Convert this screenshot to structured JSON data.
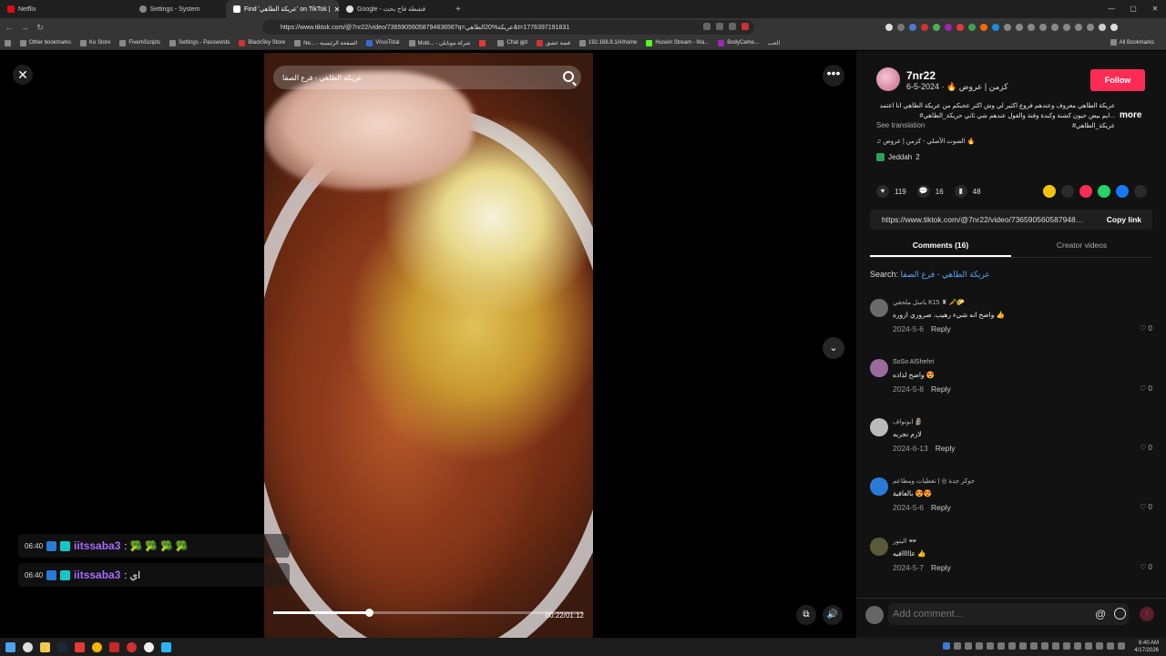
{
  "browser": {
    "tabs": [
      {
        "label": "Netflix",
        "color": "#e50914"
      },
      {
        "label": "Settings - System",
        "color": "#888888"
      },
      {
        "label": "Find 'عريكة الطاهي' on TikTok |",
        "color": "#ffffff",
        "active": true
      },
      {
        "label": "Google - قشطة فاخ بحث",
        "color": "#dddddd"
      }
    ],
    "url": "https://www.tiktok.com/@7nr22/video/7365905605879483656?q=عريكة%20الطاهي&t=1776397191831",
    "bookmarks": [
      "Other bookmarks",
      "Ko Store",
      "FivemScripts",
      "Settings - Passwords",
      "BlackSky Store",
      "Ne... - الصفحة الرئيسية",
      "VirusTotal",
      "Mobi... - شركة موبايلي",
      "",
      "Chat gpt",
      "قصة عشق",
      "192.168.8.1/#/home",
      "Husein Stream - Wa...",
      "BodyCame...",
      "الجب"
    ],
    "all_bookmarks": "All Bookmarks"
  },
  "video": {
    "search_placeholder": "عريكة الطاهي - فرع الصفا",
    "time": "00:22/01:12",
    "progress": 0.31
  },
  "chat": [
    {
      "time": "06:40",
      "user": "iitssaba3",
      "msg": ": 🥦 🥦 🥦 🥦"
    },
    {
      "time": "06:40",
      "user": "iitssaba3",
      "msg": ": اي"
    }
  ],
  "panel": {
    "author": "7nr22",
    "author_sub": "كزمن | عروض 🔥 · 2024-5-6",
    "follow": "Follow",
    "desc": "عريكة الطاهي معروف وعندهم فروع اكثير لي وش اكثر عجبكم من عريكة الطاهي انا اعتمد ...ايم بيض حيون كشنة وكبدة وفنة والفول عندهم شي ثاني حريكة_الطاهي# عريكة_الطاهي#",
    "more": "more",
    "see_translation": "See translation",
    "music": "♫  الصوت الأصلي - كزمن | عروض 🔥",
    "location": "Jeddah",
    "location_count": "2",
    "likes": "119",
    "comments_count": "16",
    "saves": "48",
    "link": "https://www.tiktok.com/@7nr22/video/7365905605879483656",
    "copy_link": "Copy link",
    "tab_comments": "Comments (16)",
    "tab_creator": "Creator videos",
    "search_label": "Search:",
    "search_query": "عريكة الطاهي - فرع الصفا",
    "add_comment": "Add comment...",
    "reply": "Reply",
    "comments": [
      {
        "user": "باسل ملحقي K15 ♜ 🥕🌮",
        "text": "واضح انه شيء رهيب. ضروري ازوره 👍",
        "date": "2024-5-6",
        "likes": "0",
        "color": "#6a6a6a"
      },
      {
        "user": "SoSo AlShehri",
        "text": "واضح لذاذه 😍",
        "date": "2024-5-8",
        "likes": "0",
        "color": "#9a6b9c"
      },
      {
        "user": "ابونواف 🗿",
        "text": "لازم نجربه",
        "date": "2024-6-13",
        "likes": "0",
        "color": "#bbbbbb"
      },
      {
        "user": "جوكر جدة ◎ | تغطيات ومطاعم",
        "text": "بالعافية 😍😍",
        "date": "2024-5-6",
        "likes": "0",
        "color": "#2a7bd6"
      },
      {
        "user": "اليتور 🕶",
        "text": "عااااافيه 👍",
        "date": "2024-5-7",
        "likes": "0",
        "color": "#5a5a3a"
      }
    ]
  },
  "taskbar": {
    "time": "6:40 AM",
    "date": "4/17/2026"
  }
}
